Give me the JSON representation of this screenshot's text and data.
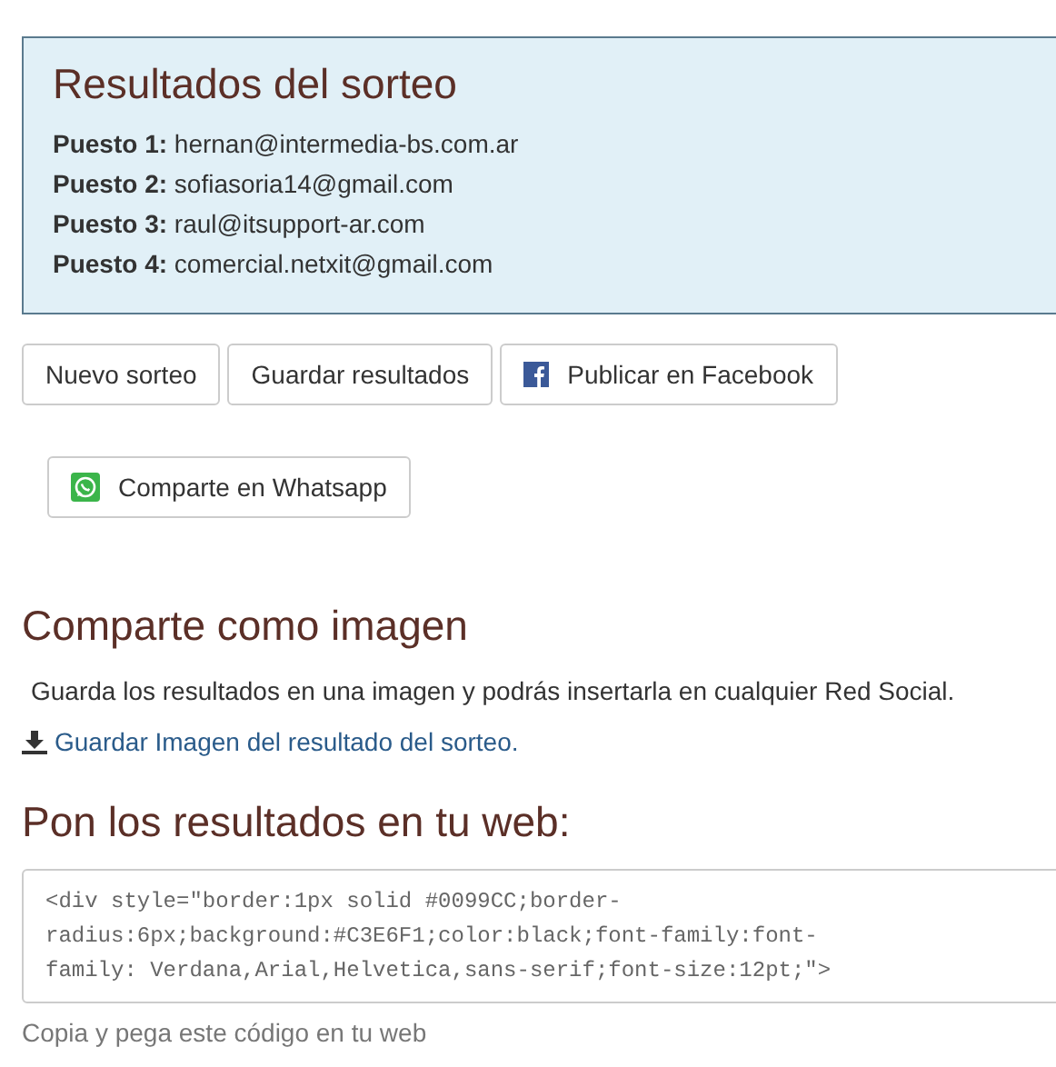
{
  "results": {
    "title": "Resultados del sorteo",
    "places": [
      {
        "label": "Puesto 1:",
        "email": "hernan@intermedia-bs.com.ar"
      },
      {
        "label": "Puesto 2:",
        "email": "sofiasoria14@gmail.com"
      },
      {
        "label": "Puesto 3:",
        "email": "raul@itsupport-ar.com"
      },
      {
        "label": "Puesto 4:",
        "email": "comercial.netxit@gmail.com"
      }
    ]
  },
  "buttons": [
    {
      "label": "Nuevo sorteo",
      "kind": "plain"
    },
    {
      "label": "Guardar resultados",
      "kind": "plain"
    },
    {
      "label": "Publicar en Facebook",
      "kind": "facebook"
    }
  ],
  "whatsapp_button": {
    "label": "Comparte en Whatsapp"
  },
  "image_section": {
    "title": "Comparte como imagen",
    "text": "Guarda los resultados en una imagen y podrás insertarla en cualquier Red Social.",
    "link": "Guardar Imagen del resultado del sorteo."
  },
  "embed_section": {
    "title": "Pon los resultados en tu web:",
    "code_lines": [
      "<div style=\"border:1px solid #0099CC;border-",
      "radius:6px;background:#C3E6F1;color:black;font-family:font-",
      "family: Verdana,Arial,Helvetica,sans-serif;font-size:12pt;\">"
    ],
    "hint": "Copia y pega este código en tu web"
  }
}
